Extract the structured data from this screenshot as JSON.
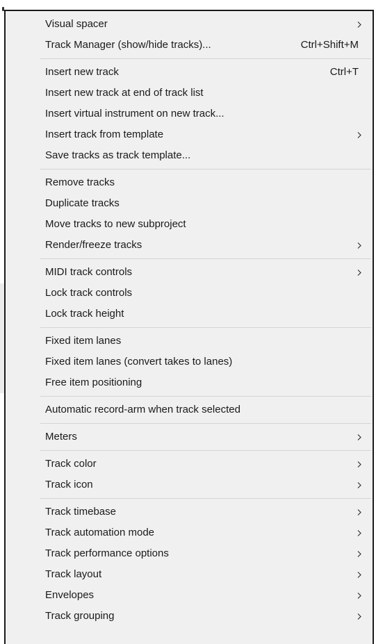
{
  "menu": {
    "groups": [
      {
        "items": [
          {
            "label": "Visual spacer",
            "shortcut": "",
            "submenu": true
          },
          {
            "label": "Track Manager (show/hide tracks)...",
            "shortcut": "Ctrl+Shift+M",
            "submenu": false
          }
        ]
      },
      {
        "items": [
          {
            "label": "Insert new track",
            "shortcut": "Ctrl+T",
            "submenu": false
          },
          {
            "label": "Insert new track at end of track list",
            "shortcut": "",
            "submenu": false
          },
          {
            "label": "Insert virtual instrument on new track...",
            "shortcut": "",
            "submenu": false
          },
          {
            "label": "Insert track from template",
            "shortcut": "",
            "submenu": true
          },
          {
            "label": "Save tracks as track template...",
            "shortcut": "",
            "submenu": false
          }
        ]
      },
      {
        "items": [
          {
            "label": "Remove tracks",
            "shortcut": "",
            "submenu": false
          },
          {
            "label": "Duplicate tracks",
            "shortcut": "",
            "submenu": false
          },
          {
            "label": "Move tracks to new subproject",
            "shortcut": "",
            "submenu": false
          },
          {
            "label": "Render/freeze tracks",
            "shortcut": "",
            "submenu": true
          }
        ]
      },
      {
        "items": [
          {
            "label": "MIDI track controls",
            "shortcut": "",
            "submenu": true
          },
          {
            "label": "Lock track controls",
            "shortcut": "",
            "submenu": false
          },
          {
            "label": "Lock track height",
            "shortcut": "",
            "submenu": false
          }
        ]
      },
      {
        "items": [
          {
            "label": "Fixed item lanes",
            "shortcut": "",
            "submenu": false
          },
          {
            "label": "Fixed item lanes (convert takes to lanes)",
            "shortcut": "",
            "submenu": false
          },
          {
            "label": "Free item positioning",
            "shortcut": "",
            "submenu": false
          }
        ]
      },
      {
        "items": [
          {
            "label": "Automatic record-arm when track selected",
            "shortcut": "",
            "submenu": false
          }
        ]
      },
      {
        "items": [
          {
            "label": "Meters",
            "shortcut": "",
            "submenu": true
          }
        ]
      },
      {
        "items": [
          {
            "label": "Track color",
            "shortcut": "",
            "submenu": true
          },
          {
            "label": "Track icon",
            "shortcut": "",
            "submenu": true
          }
        ]
      },
      {
        "items": [
          {
            "label": "Track timebase",
            "shortcut": "",
            "submenu": true
          },
          {
            "label": "Track automation mode",
            "shortcut": "",
            "submenu": true
          },
          {
            "label": "Track performance options",
            "shortcut": "",
            "submenu": true
          },
          {
            "label": "Track layout",
            "shortcut": "",
            "submenu": true
          },
          {
            "label": "Envelopes",
            "shortcut": "",
            "submenu": true
          },
          {
            "label": "Track grouping",
            "shortcut": "",
            "submenu": true
          }
        ]
      }
    ]
  },
  "icons": {
    "submenu_arrow": "chevron-right-icon"
  },
  "colors": {
    "menu_background": "#f0f0f0",
    "menu_text": "#1a1a1a",
    "separator": "#d4d4d4",
    "border": "#1a1a1a"
  }
}
